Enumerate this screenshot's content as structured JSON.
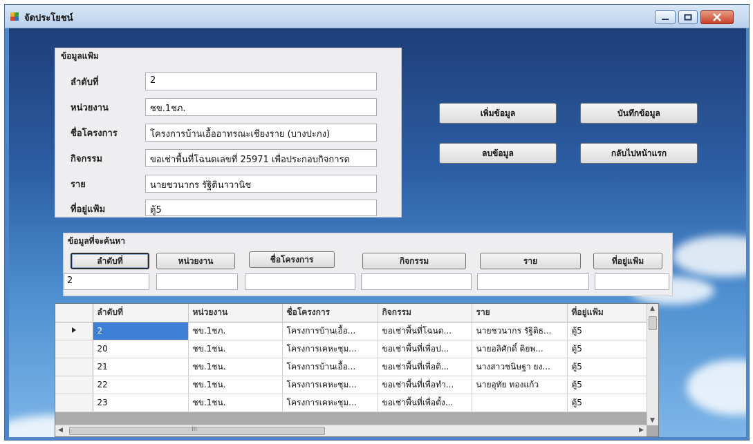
{
  "window": {
    "title": "จัดประโยชน์"
  },
  "file_info": {
    "legend": "ข้อมูลแฟ้ม",
    "fields": [
      {
        "label": "ลำดับที่",
        "value": "2"
      },
      {
        "label": "หน่วยงาน",
        "value": "ชข.1ชภ."
      },
      {
        "label": "ชื่อโครงการ",
        "value": "โครงการบ้านเอื้ออาทรณะเชียงราย (บางปะกง)"
      },
      {
        "label": "กิจกรรม",
        "value": "ขอเช่าพื้นที่โฉนดเลขที่ 25971 เพื่อประกอบกิจการต"
      },
      {
        "label": "ราย",
        "value": "นายชวนากร รัฐิตินาวานิช"
      },
      {
        "label": "ที่อยู่แฟ้ม",
        "value": "ตู้5"
      }
    ]
  },
  "actions": {
    "add": "เพิ่มข้อมูล",
    "save": "บันทึกข้อมูล",
    "delete": "ลบข้อมูล",
    "back": "กลับไปหน้าแรก"
  },
  "search": {
    "legend": "ข้อมูลที่จะค้นหา",
    "buttons": [
      "ลำดับที่",
      "หน่วยงาน",
      "ชื่อโครงการ",
      "กิจกรรม",
      "ราย",
      "ที่อยู่แฟ้ม"
    ],
    "values": [
      "2",
      "",
      "",
      "",
      "",
      ""
    ]
  },
  "grid": {
    "columns": [
      "ลำดับที่",
      "หน่วยงาน",
      "ชื่อโครงการ",
      "กิจกรรม",
      "ราย",
      "ที่อยู่แฟ้ม"
    ],
    "rows": [
      [
        "2",
        "ชข.1ชภ.",
        "โครงการบ้านเอื้อ...",
        "ขอเช่าพื้นที่โฉนด...",
        "นายชวนากร รัฐิติธ...",
        "ตู้5"
      ],
      [
        "20",
        "ชข.1ชน.",
        "โครงการเคหะชุม...",
        "ขอเช่าพื้นที่เพื่อป...",
        "นายอลิศักดิ์ ติยพ...",
        "ตู้5"
      ],
      [
        "21",
        "ชข.1ชน.",
        "โครงการบ้านเอื้อ...",
        "ขอเช่าพื้นที่เพื่อติ...",
        "นางสาวชนิษฐา ยง...",
        "ตู้5"
      ],
      [
        "22",
        "ชข.1ชน.",
        "โครงการเคหะชุม...",
        "ขอเช่าพื้นที่เพื่อทำ...",
        "นายอุทัย ทองแก้ว",
        "ตู้5"
      ],
      [
        "23",
        "ชข.1ชน.",
        "โครงการเคหะชุม...",
        "ขอเช่าพื้นที่เพื่อตั้ง...",
        "",
        "ตู้5"
      ]
    ],
    "scroll_glyph": "III"
  },
  "colors": {
    "selected_cell": "#3d7fd4",
    "close_button": "#c9412c"
  }
}
